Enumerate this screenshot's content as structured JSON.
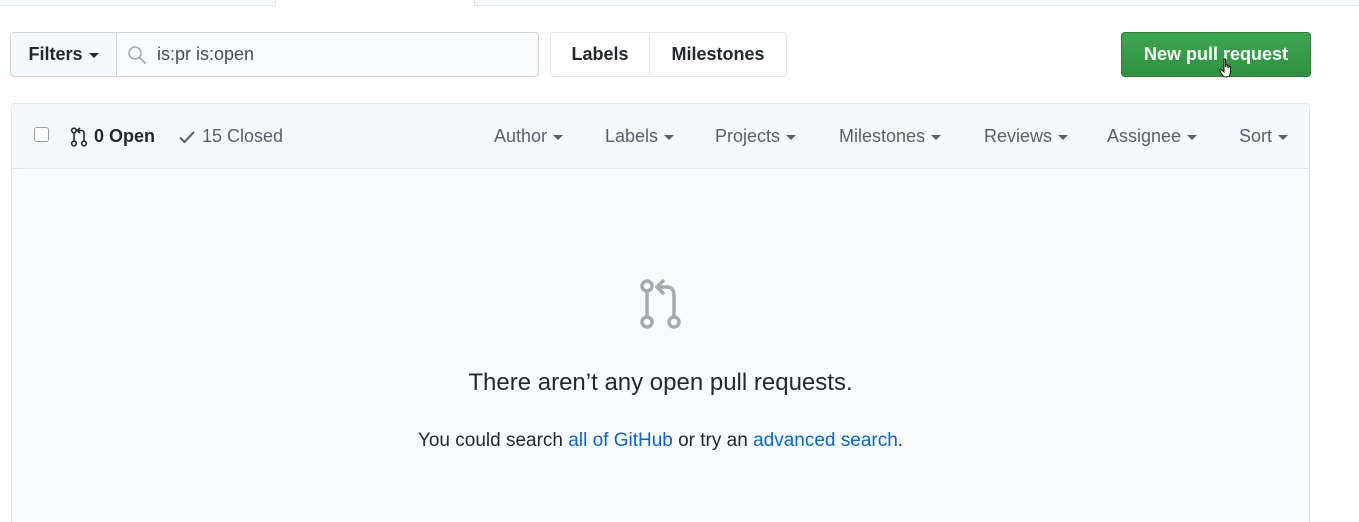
{
  "toolbar": {
    "filters_label": "Filters",
    "search_value": "is:pr is:open",
    "labels_label": "Labels",
    "milestones_label": "Milestones",
    "new_pr_label": "New pull request"
  },
  "header": {
    "open_count": "0 Open",
    "closed_count": "15 Closed",
    "menus": [
      "Author",
      "Labels",
      "Projects",
      "Milestones",
      "Reviews",
      "Assignee",
      "Sort"
    ]
  },
  "blankslate": {
    "title": "There aren’t any open pull requests.",
    "desc_prefix": "You could search ",
    "link1": "all of GitHub",
    "desc_middle": " or try an ",
    "link2": "advanced search",
    "desc_suffix": "."
  },
  "colors": {
    "primary_button": "#2ea44f",
    "link": "#0366d6"
  },
  "icons": {
    "search": "search-icon",
    "pull_request": "git-pull-request-icon",
    "check": "check-icon",
    "cursor": "hand-pointer-icon"
  }
}
